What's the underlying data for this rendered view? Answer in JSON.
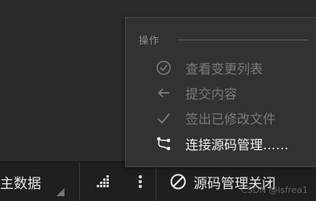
{
  "status_bar": {
    "data_label": "主数据",
    "scm_label": "源码管理关闭"
  },
  "menu": {
    "section_title": "操作",
    "items": [
      {
        "label": "查看变更列表",
        "icon": "check-circle-icon",
        "enabled": false
      },
      {
        "label": "提交内容",
        "icon": "arrow-left-icon",
        "enabled": false
      },
      {
        "label": "签出已修改文件",
        "icon": "check-icon",
        "enabled": false
      },
      {
        "label": "连接源码管理……",
        "icon": "branch-icon",
        "enabled": true
      }
    ]
  },
  "watermark": "CSDN @lsfrea1"
}
